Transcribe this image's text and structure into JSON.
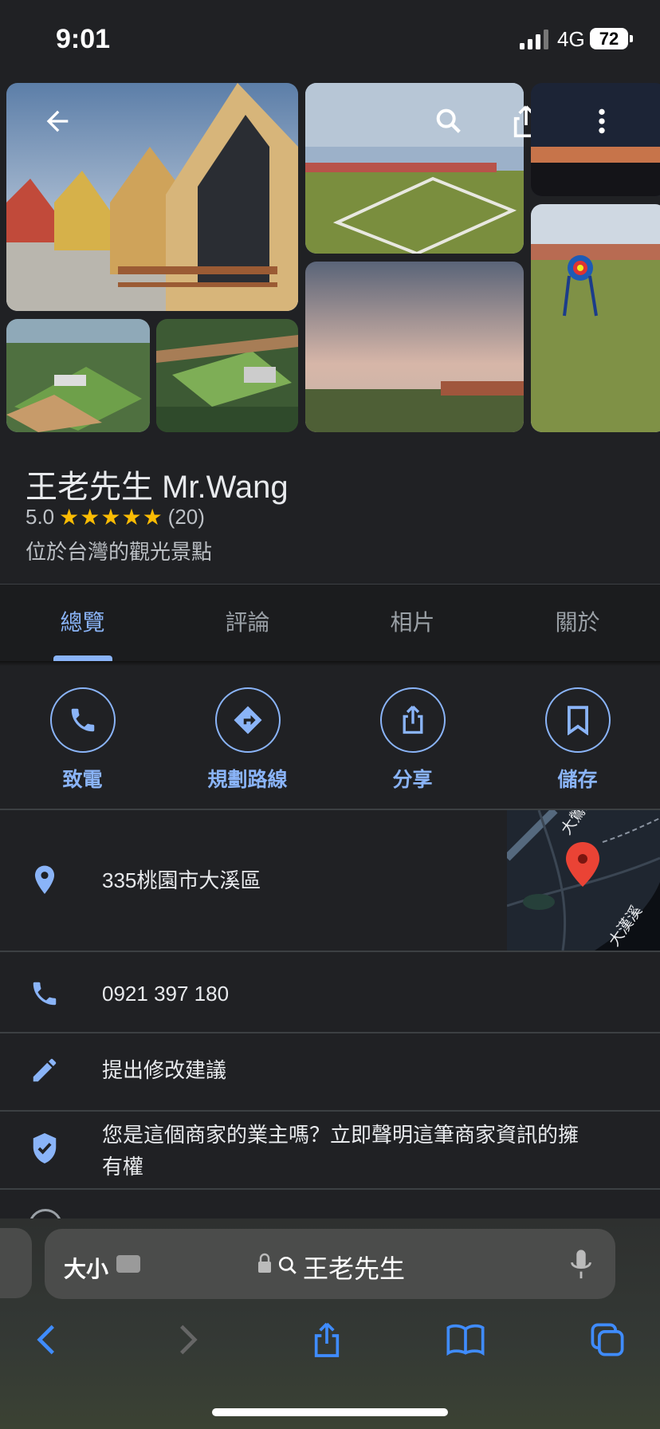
{
  "status_bar": {
    "time": "9:01",
    "network": "4G",
    "battery": "72"
  },
  "place": {
    "name": "王老先生 Mr.Wang",
    "rating": "5.0",
    "stars": "★★★★★",
    "review_count": "(20)",
    "category": "位於台灣的觀光景點"
  },
  "tabs": [
    {
      "label": "總覽",
      "active": true
    },
    {
      "label": "評論",
      "active": false
    },
    {
      "label": "相片",
      "active": false
    },
    {
      "label": "關於",
      "active": false
    }
  ],
  "actions": [
    {
      "label": "致電",
      "icon": "phone-icon"
    },
    {
      "label": "規劃路線",
      "icon": "directions-icon"
    },
    {
      "label": "分享",
      "icon": "share-icon"
    },
    {
      "label": "儲存",
      "icon": "bookmark-icon"
    }
  ],
  "info": {
    "address": "335桃園市大溪區",
    "phone": "0921 397 180",
    "suggest_edit": "提出修改建議",
    "claim_line1": "您是這個商家的業主嗎？立即聲明這筆商家資訊的擁",
    "claim_line2": "有權"
  },
  "map": {
    "road_label": "大鶯路",
    "river_label": "大漢溪"
  },
  "browser": {
    "text_size": "大小",
    "url": "王老先生"
  },
  "colors": {
    "accent": "#8ab4f8",
    "background": "#202124",
    "star": "#fbbc04",
    "pin": "#ea4335"
  }
}
